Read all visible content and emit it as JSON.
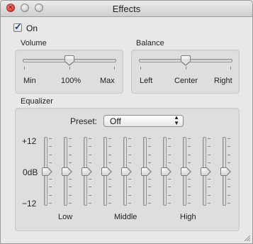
{
  "window": {
    "title": "Effects"
  },
  "toggle": {
    "label": "On",
    "checked": true
  },
  "volume": {
    "title": "Volume",
    "min_label": "Min",
    "mid_label": "100%",
    "max_label": "Max",
    "level_fraction": 0.5
  },
  "balance": {
    "title": "Balance",
    "left_label": "Left",
    "center_label": "Center",
    "right_label": "Right",
    "level_fraction": 0.5
  },
  "equalizer": {
    "title": "Equalizer",
    "preset_label": "Preset:",
    "preset_value": "Off",
    "db_labels": [
      "+12",
      "0dB",
      "−12"
    ],
    "band_labels": [
      "Low",
      "Middle",
      "High"
    ],
    "bands": [
      {
        "name": "band-1",
        "db": 0
      },
      {
        "name": "band-2",
        "db": 0
      },
      {
        "name": "band-3",
        "db": 0
      },
      {
        "name": "band-4",
        "db": 0
      },
      {
        "name": "band-5",
        "db": 0
      },
      {
        "name": "band-6",
        "db": 0
      },
      {
        "name": "band-7",
        "db": 0
      },
      {
        "name": "band-8",
        "db": 0
      },
      {
        "name": "band-9",
        "db": 0
      },
      {
        "name": "band-10",
        "db": 0
      }
    ]
  }
}
